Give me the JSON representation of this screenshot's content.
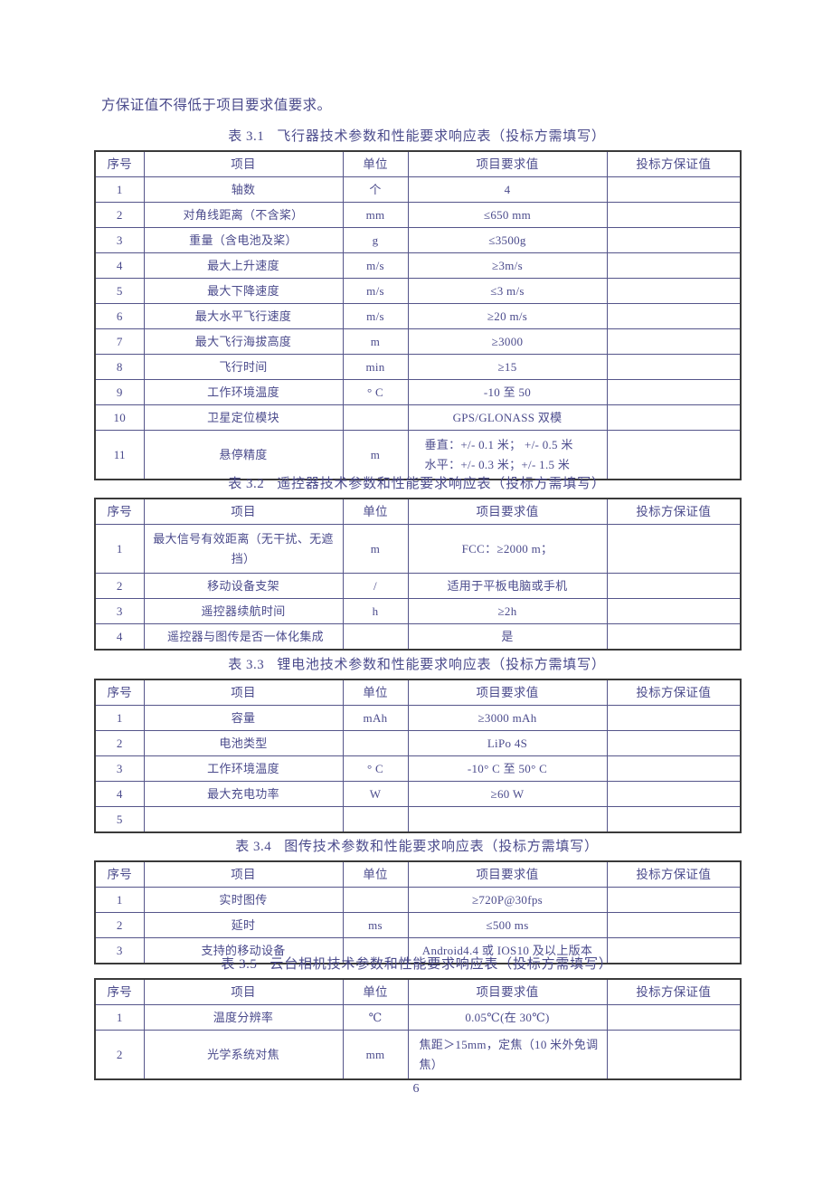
{
  "document": {
    "intro_text": "方保证值不得低于项目要求值要求。",
    "page_number": "6"
  },
  "column_headers": {
    "no": "序号",
    "item": "项目",
    "unit": "单位",
    "required": "项目要求值",
    "guaranteed": "投标方保证值"
  },
  "tables": [
    {
      "number": "表 3.1",
      "title": "飞行器技术参数和性能要求响应表（投标方需填写）",
      "rows": [
        {
          "no": "1",
          "item": "轴数",
          "unit": "个",
          "required": "4",
          "guaranteed": ""
        },
        {
          "no": "2",
          "item": "对角线距离（不含桨）",
          "unit": "mm",
          "required": "≤650 mm",
          "guaranteed": ""
        },
        {
          "no": "3",
          "item": "重量（含电池及桨）",
          "unit": "g",
          "required": "≤3500g",
          "guaranteed": ""
        },
        {
          "no": "4",
          "item": "最大上升速度",
          "unit": "m/s",
          "required": "≥3m/s",
          "guaranteed": ""
        },
        {
          "no": "5",
          "item": "最大下降速度",
          "unit": "m/s",
          "required": "≤3 m/s",
          "guaranteed": ""
        },
        {
          "no": "6",
          "item": "最大水平飞行速度",
          "unit": "m/s",
          "required": "≥20 m/s",
          "guaranteed": ""
        },
        {
          "no": "7",
          "item": "最大飞行海拔高度",
          "unit": "m",
          "required": "≥3000",
          "guaranteed": ""
        },
        {
          "no": "8",
          "item": "飞行时间",
          "unit": "min",
          "required": "≥15",
          "guaranteed": ""
        },
        {
          "no": "9",
          "item": "工作环境温度",
          "unit": "° C",
          "required": "-10 至 50",
          "guaranteed": ""
        },
        {
          "no": "10",
          "item": "卫星定位模块",
          "unit": "",
          "required": "GPS/GLONASS 双模",
          "guaranteed": ""
        },
        {
          "no": "11",
          "item": "悬停精度",
          "unit": "m",
          "required_lines": [
            "垂直：+/- 0.1 米；  +/- 0.5 米",
            "水平：+/- 0.3 米；+/- 1.5 米"
          ],
          "guaranteed": ""
        }
      ]
    },
    {
      "number": "表 3.2",
      "title": "遥控器技术参数和性能要求响应表（投标方需填写）",
      "rows": [
        {
          "no": "1",
          "item": "最大信号有效距离（无干扰、无遮挡）",
          "unit": "m",
          "required": "FCC：≥2000 m；",
          "guaranteed": ""
        },
        {
          "no": "2",
          "item": "移动设备支架",
          "unit": "/",
          "required": "适用于平板电脑或手机",
          "guaranteed": ""
        },
        {
          "no": "3",
          "item": "遥控器续航时间",
          "unit": "h",
          "required": "≥2h",
          "guaranteed": ""
        },
        {
          "no": "4",
          "item": "遥控器与图传是否一体化集成",
          "unit": "",
          "required": "是",
          "guaranteed": ""
        }
      ]
    },
    {
      "number": "表 3.3",
      "title": "锂电池技术参数和性能要求响应表（投标方需填写）",
      "rows": [
        {
          "no": "1",
          "item": "容量",
          "unit": "mAh",
          "required": "≥3000 mAh",
          "guaranteed": ""
        },
        {
          "no": "2",
          "item": "电池类型",
          "unit": "",
          "required": "LiPo 4S",
          "guaranteed": ""
        },
        {
          "no": "3",
          "item": "工作环境温度",
          "unit": "° C",
          "required": "-10° C 至 50° C",
          "guaranteed": ""
        },
        {
          "no": "4",
          "item": "最大充电功率",
          "unit": "W",
          "required": "≥60 W",
          "guaranteed": ""
        },
        {
          "no": "5",
          "item": "",
          "unit": "",
          "required": "",
          "guaranteed": ""
        }
      ]
    },
    {
      "number": "表 3.4",
      "title": "图传技术参数和性能要求响应表（投标方需填写）",
      "rows": [
        {
          "no": "1",
          "item": "实时图传",
          "unit": "",
          "required": "≥720P@30fps",
          "guaranteed": ""
        },
        {
          "no": "2",
          "item": "延时",
          "unit": "ms",
          "required": "≤500 ms",
          "guaranteed": ""
        },
        {
          "no": "3",
          "item": "支持的移动设备",
          "unit": "",
          "required": "Android4.4 或 IOS10 及以上版本",
          "guaranteed": ""
        }
      ]
    },
    {
      "number": "表 3.5",
      "title": "云台相机技术参数和性能要求响应表（投标方需填写）",
      "rows": [
        {
          "no": "1",
          "item": "温度分辨率",
          "unit": "℃",
          "required": "0.05℃(在 30℃)",
          "guaranteed": ""
        },
        {
          "no": "2",
          "item": "光学系统对焦",
          "unit": "mm",
          "required_lines": [
            "焦距＞15mm，定焦（10 米外免调",
            "焦）"
          ],
          "guaranteed": ""
        }
      ]
    }
  ]
}
